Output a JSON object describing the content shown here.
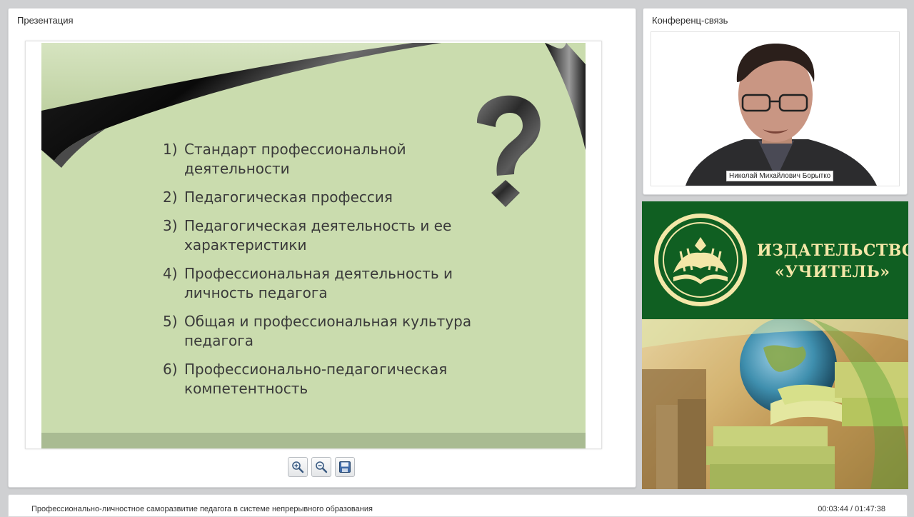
{
  "presentation": {
    "title": "Презентация",
    "slide": {
      "items": [
        {
          "num": "1)",
          "text": "Стандарт профессиональной деятельности"
        },
        {
          "num": "2)",
          "text": "Педагогическая профессия"
        },
        {
          "num": "3)",
          "text": "Педагогическая деятельность и ее характеристики"
        },
        {
          "num": "4)",
          "text": "Профессиональная деятельность и личность педагога"
        },
        {
          "num": "5)",
          "text": "Общая и профессиональная культура педагога"
        },
        {
          "num": "6)",
          "text": "Профессионально-педагогическая компетентность"
        }
      ],
      "colors": {
        "background": "#cadcae",
        "footer": "#a9bb92",
        "text": "#3a3a3a"
      }
    },
    "toolbar": {
      "zoom_in_icon": "zoom-in-icon",
      "zoom_out_icon": "zoom-out-icon",
      "save_icon": "save-icon"
    }
  },
  "conference": {
    "title": "Конференц-связь",
    "speaker_name": "Николай Михайлович Борытко"
  },
  "advert": {
    "brand_line1": "ИЗДАТЕЛЬСТВО",
    "brand_line2": "«УЧИТЕЛЬ»",
    "colors": {
      "green": "#105f22",
      "gold": "#f4e7a8"
    }
  },
  "footer": {
    "course_title": "Профессионально-личностное саморазвитие педагога в системе непрерывного образования",
    "timecode": "00:03:44 / 01:47:38"
  }
}
